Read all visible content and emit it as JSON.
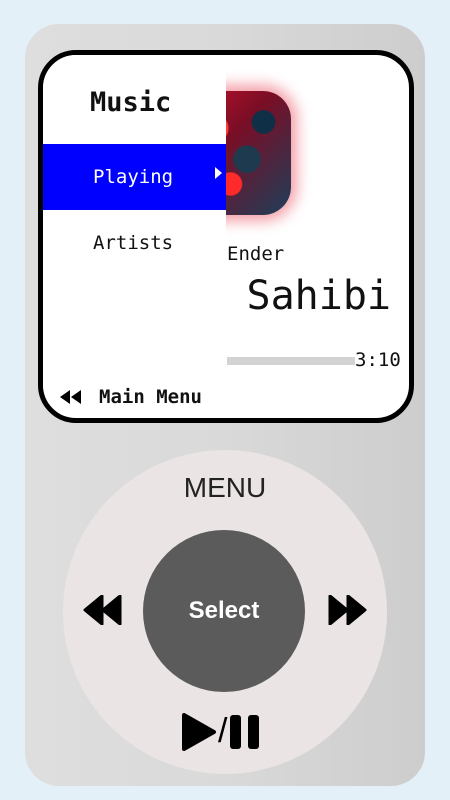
{
  "screen": {
    "menu_title": "Music",
    "menu_items": [
      {
        "label": "Playing",
        "active": true
      },
      {
        "label": "Artists",
        "active": false
      }
    ],
    "now_playing": {
      "artist": "Ender",
      "title": "Sahibi",
      "time": "3:10",
      "progress": 0
    },
    "back_label": "Main Menu"
  },
  "wheel": {
    "menu_label": "MENU",
    "select_label": "Select",
    "icons": {
      "prev": "rewind-icon",
      "next": "fast-forward-icon",
      "play": "play-icon",
      "pause": "pause-icon",
      "play_pause_separator": "/"
    }
  },
  "colors": {
    "highlight": "#0000ff",
    "wheel_center": "#5b5b5b",
    "wheel": "#ebe4e4",
    "body": "#d9d9d9"
  }
}
